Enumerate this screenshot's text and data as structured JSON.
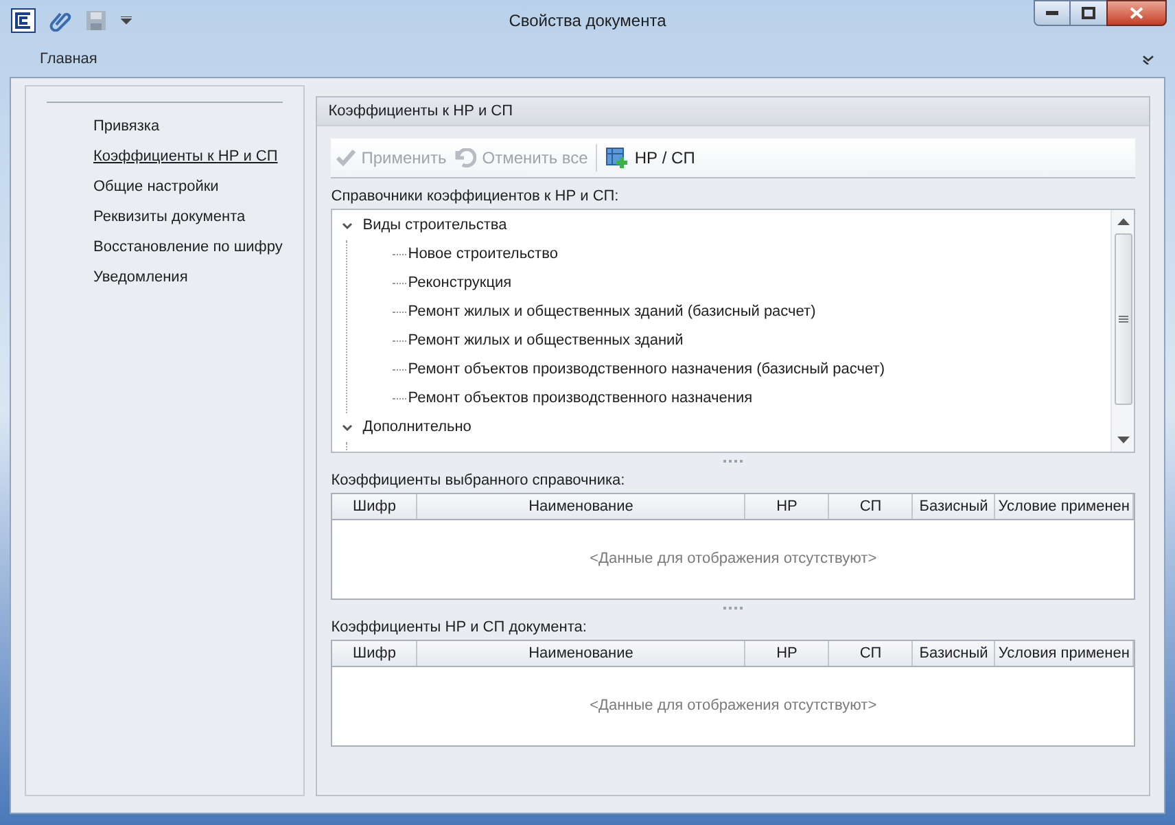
{
  "window": {
    "title": "Свойства документа"
  },
  "ribbon": {
    "tabs": [
      {
        "label": "Главная",
        "selected": true
      }
    ]
  },
  "sidebar": {
    "items": [
      {
        "label": "Привязка",
        "selected": false
      },
      {
        "label": "Коэффициенты к НР и СП",
        "selected": true
      },
      {
        "label": "Общие настройки",
        "selected": false
      },
      {
        "label": "Реквизиты документа",
        "selected": false
      },
      {
        "label": "Восстановление по шифру",
        "selected": false
      },
      {
        "label": "Уведомления",
        "selected": false
      }
    ]
  },
  "panel": {
    "title": "Коэффициенты к НР и СП",
    "toolbar": [
      {
        "kind": "apply",
        "label": "Применить",
        "disabled": true
      },
      {
        "kind": "undo",
        "label": "Отменить все",
        "disabled": true
      },
      {
        "kind": "add",
        "label": "НР / СП",
        "disabled": false
      }
    ],
    "tree_label": "Справочники коэффициентов к НР и СП:",
    "tree": [
      {
        "label": "Виды строительства",
        "expanded": true,
        "children": [
          {
            "label": "Новое строительство"
          },
          {
            "label": "Реконструкция"
          },
          {
            "label": "Ремонт жилых и общественных зданий  (базисный расчет)"
          },
          {
            "label": "Ремонт жилых и общественных зданий"
          },
          {
            "label": "Ремонт объектов производственного назначения (базисный расчет)"
          },
          {
            "label": "Ремонт объектов производственного назначения"
          }
        ]
      },
      {
        "label": "Дополнительно",
        "expanded": true
      }
    ],
    "tables": [
      {
        "label": "Коэффициенты выбранного справочника:",
        "columns": [
          "Шифр",
          "Наименование",
          "НР",
          "СП",
          "Базисный",
          "Условие применен"
        ],
        "empty_text": "<Данные для отображения отсутствуют>"
      },
      {
        "label": "Коэффициенты НР и СП документа:",
        "columns": [
          "Шифр",
          "Наименование",
          "НР",
          "СП",
          "Базисный",
          "Условия применен"
        ],
        "empty_text": "<Данные для отображения отсутствуют>"
      }
    ]
  }
}
